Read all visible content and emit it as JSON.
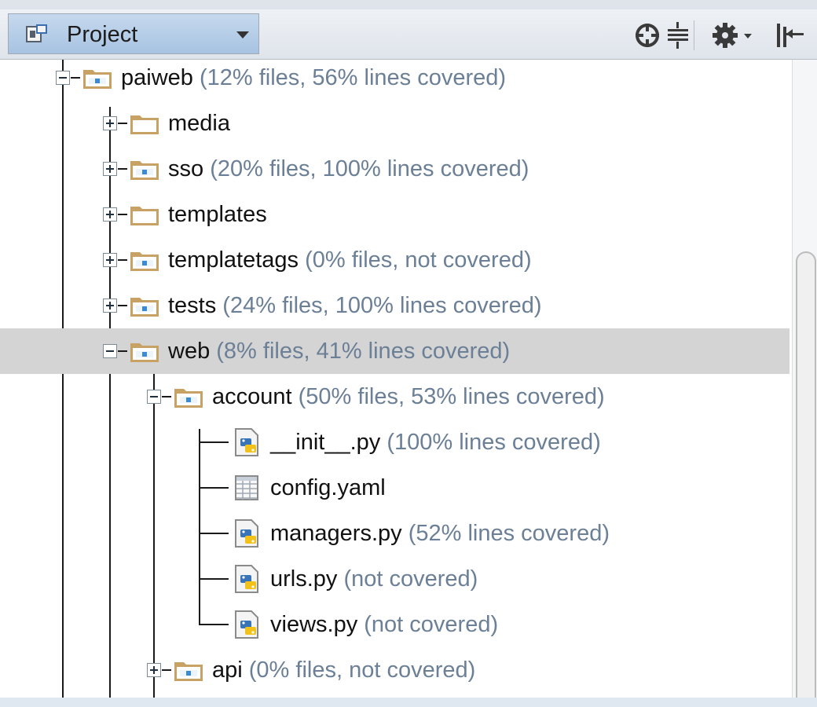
{
  "toolbar": {
    "project_label": "Project",
    "icons": [
      "locate-icon",
      "collapse-all-icon",
      "settings-icon",
      "hide-panel-icon"
    ]
  },
  "tree": {
    "rows": [
      {
        "name": "paiweb",
        "stat": " (12% files, 56% lines covered)",
        "type": "module-folder",
        "expanded": true
      },
      {
        "name": "media",
        "stat": "",
        "type": "folder",
        "expanded": false
      },
      {
        "name": "sso",
        "stat": " (20% files, 100% lines covered)",
        "type": "module-folder",
        "expanded": false
      },
      {
        "name": "templates",
        "stat": "",
        "type": "folder",
        "expanded": false
      },
      {
        "name": "templatetags",
        "stat": " (0% files, not covered)",
        "type": "module-folder",
        "expanded": false
      },
      {
        "name": "tests",
        "stat": " (24% files, 100% lines covered)",
        "type": "module-folder",
        "expanded": false
      },
      {
        "name": "web",
        "stat": " (8% files, 41% lines covered)",
        "type": "module-folder",
        "expanded": true,
        "selected": true
      },
      {
        "name": "account",
        "stat": " (50% files, 53% lines covered)",
        "type": "module-folder",
        "expanded": true
      },
      {
        "name": "__init__.py",
        "stat": " (100% lines covered)",
        "type": "python-file"
      },
      {
        "name": "config.yaml",
        "stat": "",
        "type": "yaml-file"
      },
      {
        "name": "managers.py",
        "stat": " (52% lines covered)",
        "type": "python-file"
      },
      {
        "name": "urls.py",
        "stat": " (not covered)",
        "type": "python-file"
      },
      {
        "name": "views.py",
        "stat": " (not covered)",
        "type": "python-file"
      },
      {
        "name": "api",
        "stat": " (0% files, not covered)",
        "type": "module-folder",
        "expanded": false
      }
    ]
  },
  "colors": {
    "selection": "#d4d4d4",
    "coverage_text": "#6b7f96",
    "folder": "#c8a265",
    "combo": "#b5cde8"
  }
}
